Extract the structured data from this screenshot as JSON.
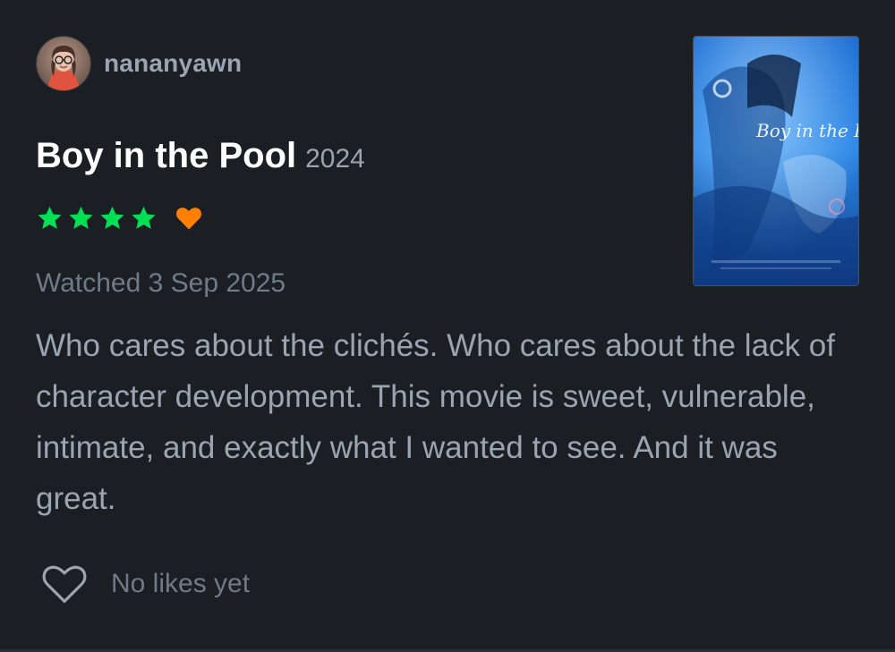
{
  "user": {
    "username": "nananyawn",
    "avatar_icon": "user-avatar-photo"
  },
  "film": {
    "title": "Boy in the Pool",
    "year": "2024",
    "poster_title": "Boy in the Pool"
  },
  "rating": {
    "stars": 4,
    "max_stars": 5,
    "liked": true,
    "star_color": "#00e054",
    "heart_color": "#ff8000"
  },
  "review": {
    "watched_label": "Watched 3 Sep 2025",
    "text": "Who cares about the clichés. Who cares about the lack of character development. This movie is sweet, vulnerable, intimate, and exactly what I wanted to see. And it was great."
  },
  "likes": {
    "text": "No likes yet",
    "icon": "heart-outline-icon"
  },
  "colors": {
    "background": "#1b1e23",
    "muted_text": "#9aa5b1",
    "dim_text": "#6f7b88"
  }
}
